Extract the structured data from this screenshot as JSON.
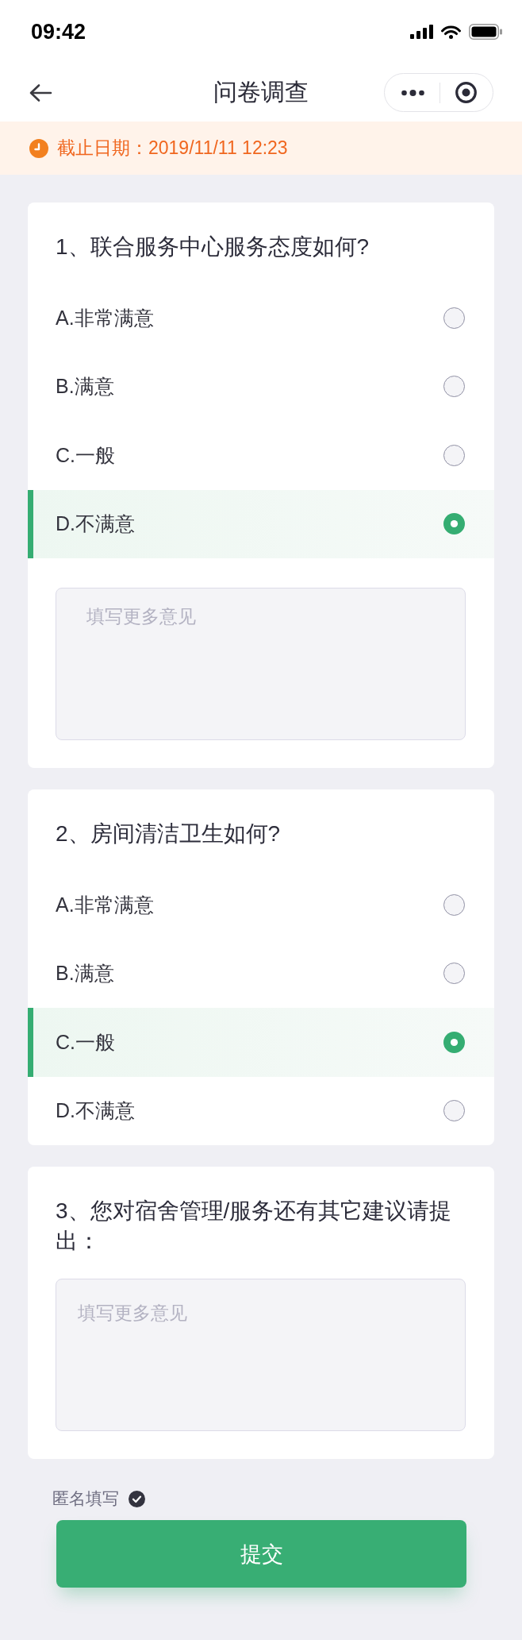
{
  "status_bar": {
    "time": "09:42"
  },
  "nav_bar": {
    "title": "问卷调查"
  },
  "deadline": {
    "text": "截止日期：2019/11/11 12:23"
  },
  "questions": [
    {
      "kind": "choice",
      "title": "1、联合服务中心服务态度如何?",
      "options": [
        {
          "label": "A.非常满意",
          "selected": false
        },
        {
          "label": "B.满意",
          "selected": false
        },
        {
          "label": "C.一般",
          "selected": false
        },
        {
          "label": "D.不满意",
          "selected": true
        }
      ],
      "comment": {
        "placeholder": "填写更多意见"
      }
    },
    {
      "kind": "choice",
      "title": "2、房间清洁卫生如何?",
      "options": [
        {
          "label": "A.非常满意",
          "selected": false
        },
        {
          "label": "B.满意",
          "selected": false
        },
        {
          "label": "C.一般",
          "selected": true
        },
        {
          "label": "D.不满意",
          "selected": false
        }
      ]
    },
    {
      "kind": "open",
      "title": "3、您对宿舍管理/服务还有其它建议请提出：",
      "comment": {
        "placeholder": "填写更多意见"
      }
    }
  ],
  "anonymous": {
    "label": "匿名填写",
    "checked": true
  },
  "submit_button": {
    "label": "提交"
  }
}
